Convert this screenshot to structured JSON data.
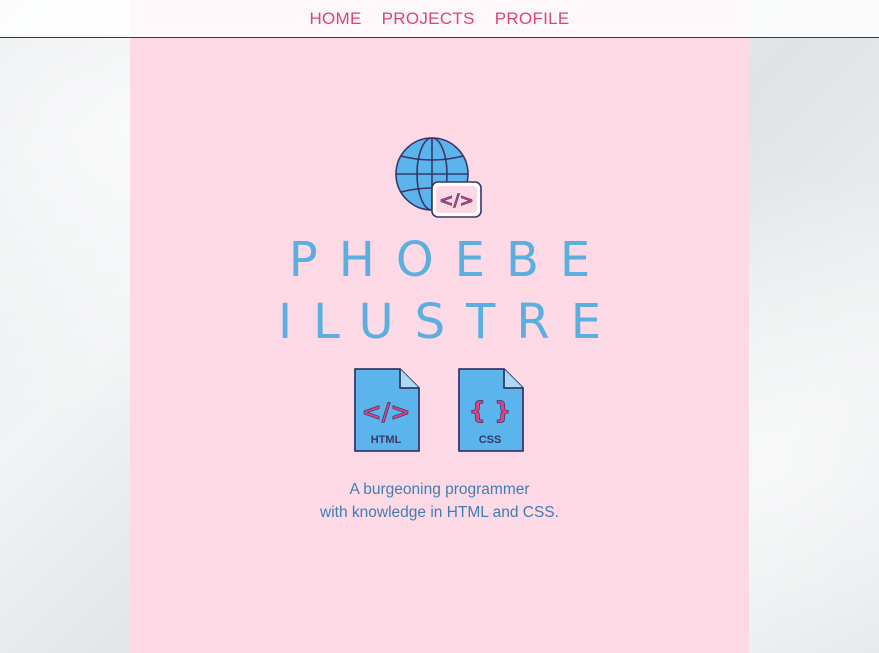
{
  "nav": {
    "items": [
      {
        "label": "HOME"
      },
      {
        "label": "PROJECTS"
      },
      {
        "label": "PROFILE"
      }
    ]
  },
  "hero": {
    "icon": "globe-code-icon",
    "first_name": "PHOEBE",
    "last_name": "ILUSTRE",
    "file_icons": [
      {
        "icon": "html-file-icon",
        "label": "HTML",
        "symbol": "</>"
      },
      {
        "icon": "css-file-icon",
        "label": "CSS",
        "symbol": "{ }"
      }
    ],
    "tagline_line1": "A burgeoning programmer",
    "tagline_line2": "with knowledge in HTML and CSS."
  },
  "colors": {
    "accent_pink": "#e0417f",
    "panel_pink": "#fdd9e6",
    "name_blue": "#5baee0",
    "icon_fill": "#5bb4ec",
    "outline": "#3b3667",
    "tagline_blue": "#3f7db4"
  }
}
